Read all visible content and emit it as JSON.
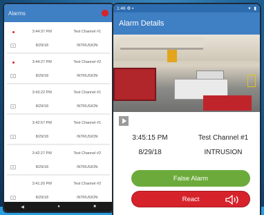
{
  "left": {
    "title": "Alarms",
    "badge": "",
    "alarms": [
      {
        "time": "3:44:37 PM",
        "date": "8/29/18",
        "channel": "Test Channel #1",
        "type": "INTRUSION",
        "unread": true
      },
      {
        "time": "3:44:27 PM",
        "date": "8/29/18",
        "channel": "Test Channel #2",
        "type": "INTRUSION",
        "unread": true
      },
      {
        "time": "3:43:22 PM",
        "date": "8/29/18",
        "channel": "Test Channel #1",
        "type": "INTRUSION",
        "unread": false
      },
      {
        "time": "3:42:57 PM",
        "date": "8/29/18",
        "channel": "Test Channel #1",
        "type": "INTRUSION",
        "unread": false
      },
      {
        "time": "3:42:27 PM",
        "date": "8/29/18",
        "channel": "Test Channel #2",
        "type": "INTRUSION",
        "unread": false
      },
      {
        "time": "3:41:20 PM",
        "date": "8/29/18",
        "channel": "Test Channel #2",
        "type": "INTRUSION",
        "unread": false
      }
    ],
    "nav": {
      "back": "◀",
      "home": "●",
      "recent": "■"
    }
  },
  "right": {
    "status": {
      "time": "1:46",
      "icons": [
        "gear-icon",
        "sim-icon",
        "wifi-icon",
        "battery-icon"
      ]
    },
    "title": "Alarm Details",
    "detail": {
      "time": "3:45:15 PM",
      "channel": "Test Channel #1",
      "date": "8/29/18",
      "type": "INTRUSION"
    },
    "buttons": {
      "false_alarm": "False Alarm",
      "react": "React"
    }
  },
  "colors": {
    "primary": "#3f7fc4",
    "status_bar": "#2d6cae",
    "false_alarm": "#6cab3b",
    "react": "#d6232b",
    "unread_dot": "#d8232a"
  }
}
